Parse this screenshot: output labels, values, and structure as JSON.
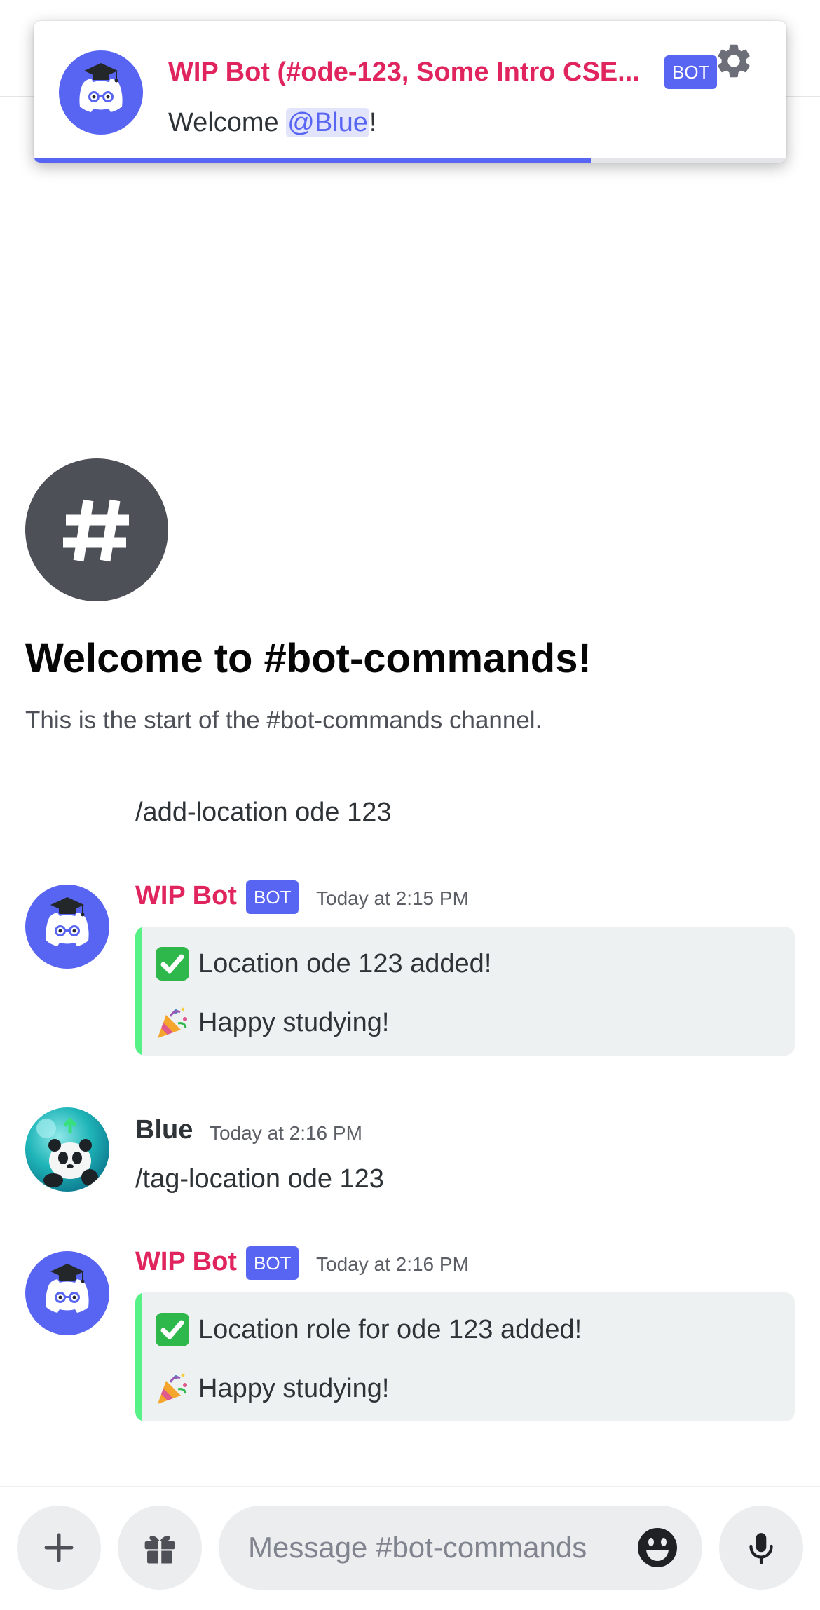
{
  "notification": {
    "title": "WIP Bot (#ode-123, Some Intro CSE...",
    "bot_tag": "BOT",
    "body_prefix": "Welcome ",
    "mention": "@Blue",
    "body_suffix": "!",
    "progress": 0.74,
    "icons": {
      "avatar": "discord-bot-avatar-icon",
      "settings": "gear-icon"
    }
  },
  "channel": {
    "icon": "hash-icon",
    "welcome_title": "Welcome to #bot-commands!",
    "welcome_subtitle": "This is the start of the #bot-commands channel."
  },
  "messages": [
    {
      "type": "command_echo",
      "text": "/add-location ode 123"
    },
    {
      "type": "bot",
      "author": "WIP Bot",
      "bot_tag": "BOT",
      "timestamp": "Today at 2:15 PM",
      "embed": {
        "line1_emoji": "check-mark-button-icon",
        "line1": "Location ode 123 added!",
        "line2_emoji": "party-popper-icon",
        "line2": "Happy studying!"
      }
    },
    {
      "type": "user",
      "author": "Blue",
      "timestamp": "Today at 2:16 PM",
      "text": "/tag-location ode 123",
      "avatar": "panda-avatar"
    },
    {
      "type": "bot",
      "author": "WIP Bot",
      "bot_tag": "BOT",
      "timestamp": "Today at 2:16 PM",
      "embed": {
        "line1_emoji": "check-mark-button-icon",
        "line1": "Location role for ode 123 added!",
        "line2_emoji": "party-popper-icon",
        "line2": "Happy studying!"
      }
    }
  ],
  "composer": {
    "placeholder": "Message #bot-commands",
    "buttons": [
      "plus-icon",
      "gift-icon",
      "emoji-icon",
      "microphone-icon"
    ]
  },
  "colors": {
    "accent": "#5865f2",
    "bot_name": "#e0245e",
    "embed_bar": "#57f287",
    "embed_bg": "#eef1f1"
  }
}
